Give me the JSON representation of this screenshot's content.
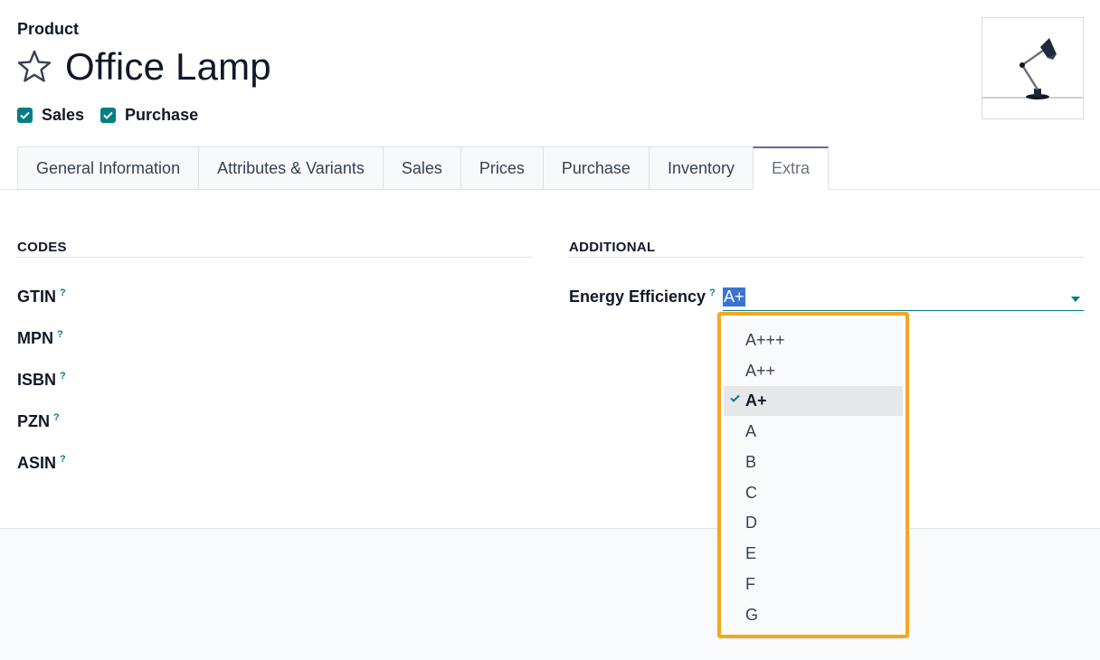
{
  "header": {
    "breadcrumb": "Product",
    "title": "Office Lamp",
    "checks": [
      {
        "label": "Sales",
        "checked": true
      },
      {
        "label": "Purchase",
        "checked": true
      }
    ]
  },
  "tabs": [
    {
      "label": "General Information"
    },
    {
      "label": "Attributes & Variants"
    },
    {
      "label": "Sales"
    },
    {
      "label": "Prices"
    },
    {
      "label": "Purchase"
    },
    {
      "label": "Inventory"
    },
    {
      "label": "Extra",
      "active": true
    }
  ],
  "codes": {
    "title": "CODES",
    "fields": [
      "GTIN",
      "MPN",
      "ISBN",
      "PZN",
      "ASIN"
    ]
  },
  "additional": {
    "title": "ADDITIONAL",
    "energy_label": "Energy Efficiency",
    "energy_value": "A+"
  },
  "help_mark": "?",
  "dropdown": {
    "options": [
      "A+++",
      "A++",
      "A+",
      "A",
      "B",
      "C",
      "D",
      "E",
      "F",
      "G"
    ],
    "selected": "A+"
  },
  "colors": {
    "accent": "#017e84",
    "highlight_border": "#f5a623",
    "tab_active": "#71639e",
    "selection": "#3b73d4"
  }
}
